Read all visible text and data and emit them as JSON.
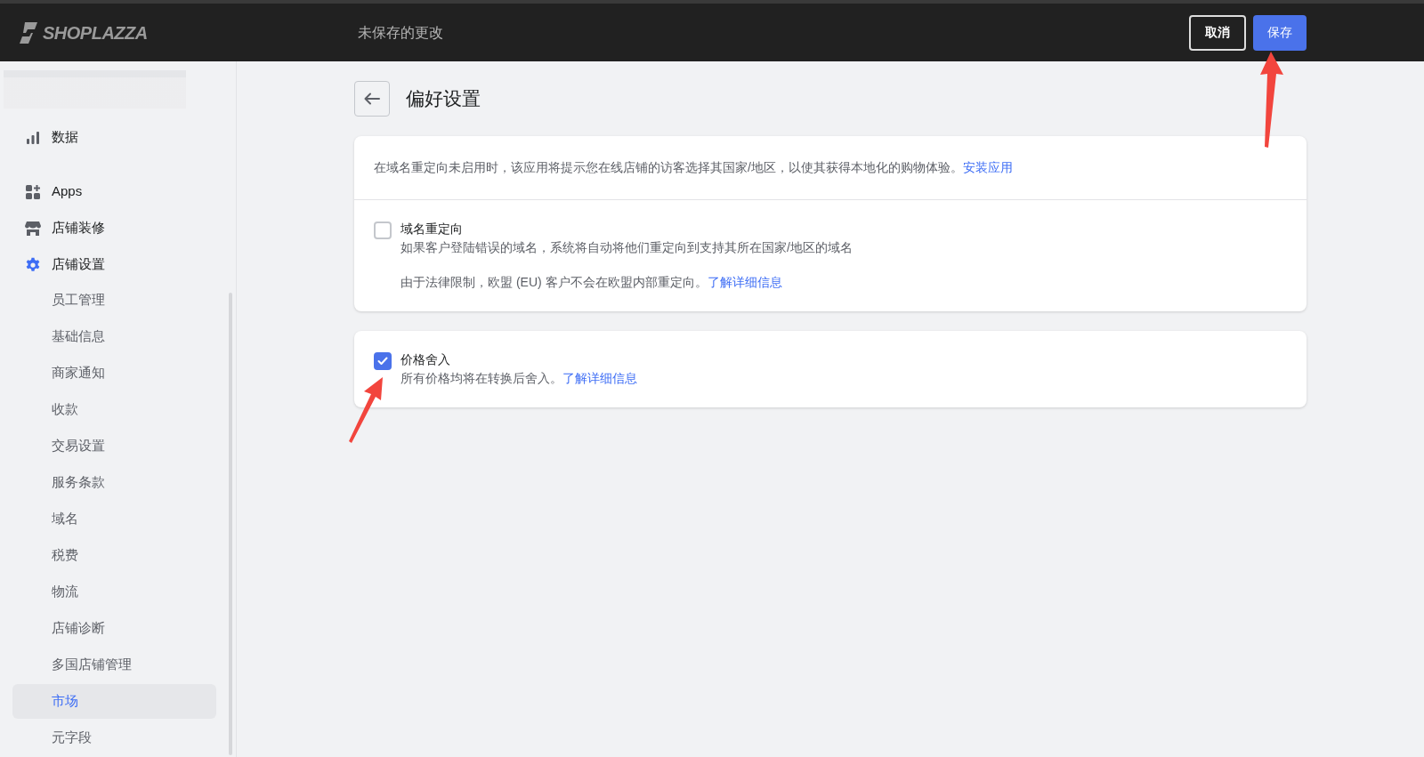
{
  "topbar": {
    "logo": "SHOPLAZZA",
    "status": "未保存的更改",
    "buttons": [
      {
        "label": "取消",
        "kind": "secondary"
      },
      {
        "label": "保存",
        "kind": "primary"
      }
    ]
  },
  "sidebar": {
    "items": [
      {
        "label": "数据",
        "kind": "chart",
        "selected": false
      },
      {
        "label": "Apps",
        "kind": "apps",
        "selected": false
      },
      {
        "label": "店铺装修",
        "kind": "store",
        "selected": false
      },
      {
        "label": "店铺设置",
        "kind": "gear",
        "selected": false,
        "children": [
          {
            "label": "员工管理",
            "selected": false
          },
          {
            "label": "基础信息",
            "selected": false
          },
          {
            "label": "商家通知",
            "selected": false
          },
          {
            "label": "收款",
            "selected": false
          },
          {
            "label": "交易设置",
            "selected": false
          },
          {
            "label": "服务条款",
            "selected": false
          },
          {
            "label": "域名",
            "selected": false
          },
          {
            "label": "税费",
            "selected": false
          },
          {
            "label": "物流",
            "selected": false
          },
          {
            "label": "店铺诊断",
            "selected": false
          },
          {
            "label": "多国店铺管理",
            "selected": false
          },
          {
            "label": "市场",
            "selected": true
          },
          {
            "label": "元字段",
            "selected": false
          }
        ]
      }
    ]
  },
  "page": {
    "title": "偏好设置",
    "intro": {
      "text": "在域名重定向未启用时，该应用将提示您在线店铺的访客选择其国家/地区，以使其获得本地化的购物体验。",
      "link": "安装应用"
    },
    "options": [
      {
        "label": "域名重定向",
        "checked": false,
        "description": "如果客户登陆错误的域名，系统将自动将他们重定向到支持其所在国家/地区的域名",
        "note": "由于法律限制，欧盟 (EU) 客户不会在欧盟内部重定向。",
        "link": "了解详细信息"
      },
      {
        "label": "价格舍入",
        "checked": true,
        "note": "所有价格均将在转换后舍入。",
        "link": "了解详细信息"
      }
    ]
  }
}
